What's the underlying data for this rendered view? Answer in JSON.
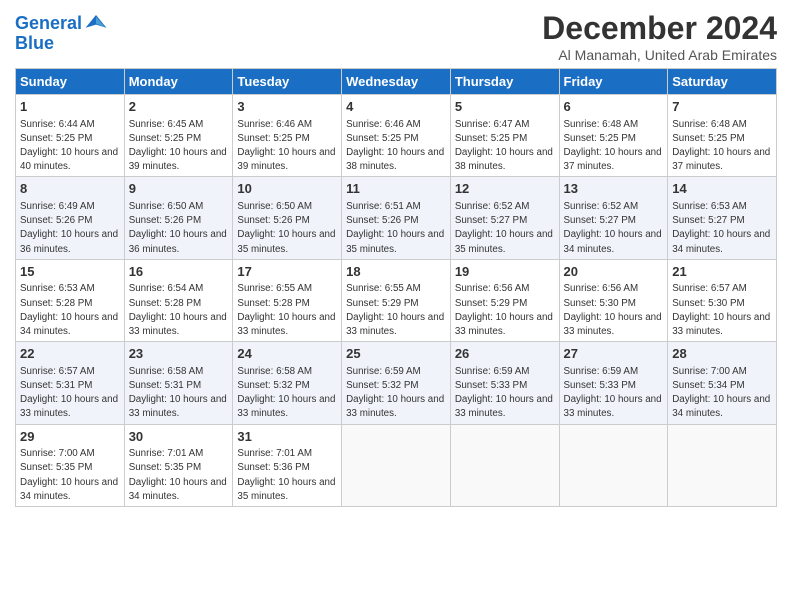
{
  "logo": {
    "line1": "General",
    "line2": "Blue"
  },
  "title": "December 2024",
  "subtitle": "Al Manamah, United Arab Emirates",
  "days_header": [
    "Sunday",
    "Monday",
    "Tuesday",
    "Wednesday",
    "Thursday",
    "Friday",
    "Saturday"
  ],
  "weeks": [
    [
      {
        "num": "1",
        "sunrise": "6:44 AM",
        "sunset": "5:25 PM",
        "daylight": "10 hours and 40 minutes."
      },
      {
        "num": "2",
        "sunrise": "6:45 AM",
        "sunset": "5:25 PM",
        "daylight": "10 hours and 39 minutes."
      },
      {
        "num": "3",
        "sunrise": "6:46 AM",
        "sunset": "5:25 PM",
        "daylight": "10 hours and 39 minutes."
      },
      {
        "num": "4",
        "sunrise": "6:46 AM",
        "sunset": "5:25 PM",
        "daylight": "10 hours and 38 minutes."
      },
      {
        "num": "5",
        "sunrise": "6:47 AM",
        "sunset": "5:25 PM",
        "daylight": "10 hours and 38 minutes."
      },
      {
        "num": "6",
        "sunrise": "6:48 AM",
        "sunset": "5:25 PM",
        "daylight": "10 hours and 37 minutes."
      },
      {
        "num": "7",
        "sunrise": "6:48 AM",
        "sunset": "5:25 PM",
        "daylight": "10 hours and 37 minutes."
      }
    ],
    [
      {
        "num": "8",
        "sunrise": "6:49 AM",
        "sunset": "5:26 PM",
        "daylight": "10 hours and 36 minutes."
      },
      {
        "num": "9",
        "sunrise": "6:50 AM",
        "sunset": "5:26 PM",
        "daylight": "10 hours and 36 minutes."
      },
      {
        "num": "10",
        "sunrise": "6:50 AM",
        "sunset": "5:26 PM",
        "daylight": "10 hours and 35 minutes."
      },
      {
        "num": "11",
        "sunrise": "6:51 AM",
        "sunset": "5:26 PM",
        "daylight": "10 hours and 35 minutes."
      },
      {
        "num": "12",
        "sunrise": "6:52 AM",
        "sunset": "5:27 PM",
        "daylight": "10 hours and 35 minutes."
      },
      {
        "num": "13",
        "sunrise": "6:52 AM",
        "sunset": "5:27 PM",
        "daylight": "10 hours and 34 minutes."
      },
      {
        "num": "14",
        "sunrise": "6:53 AM",
        "sunset": "5:27 PM",
        "daylight": "10 hours and 34 minutes."
      }
    ],
    [
      {
        "num": "15",
        "sunrise": "6:53 AM",
        "sunset": "5:28 PM",
        "daylight": "10 hours and 34 minutes."
      },
      {
        "num": "16",
        "sunrise": "6:54 AM",
        "sunset": "5:28 PM",
        "daylight": "10 hours and 33 minutes."
      },
      {
        "num": "17",
        "sunrise": "6:55 AM",
        "sunset": "5:28 PM",
        "daylight": "10 hours and 33 minutes."
      },
      {
        "num": "18",
        "sunrise": "6:55 AM",
        "sunset": "5:29 PM",
        "daylight": "10 hours and 33 minutes."
      },
      {
        "num": "19",
        "sunrise": "6:56 AM",
        "sunset": "5:29 PM",
        "daylight": "10 hours and 33 minutes."
      },
      {
        "num": "20",
        "sunrise": "6:56 AM",
        "sunset": "5:30 PM",
        "daylight": "10 hours and 33 minutes."
      },
      {
        "num": "21",
        "sunrise": "6:57 AM",
        "sunset": "5:30 PM",
        "daylight": "10 hours and 33 minutes."
      }
    ],
    [
      {
        "num": "22",
        "sunrise": "6:57 AM",
        "sunset": "5:31 PM",
        "daylight": "10 hours and 33 minutes."
      },
      {
        "num": "23",
        "sunrise": "6:58 AM",
        "sunset": "5:31 PM",
        "daylight": "10 hours and 33 minutes."
      },
      {
        "num": "24",
        "sunrise": "6:58 AM",
        "sunset": "5:32 PM",
        "daylight": "10 hours and 33 minutes."
      },
      {
        "num": "25",
        "sunrise": "6:59 AM",
        "sunset": "5:32 PM",
        "daylight": "10 hours and 33 minutes."
      },
      {
        "num": "26",
        "sunrise": "6:59 AM",
        "sunset": "5:33 PM",
        "daylight": "10 hours and 33 minutes."
      },
      {
        "num": "27",
        "sunrise": "6:59 AM",
        "sunset": "5:33 PM",
        "daylight": "10 hours and 33 minutes."
      },
      {
        "num": "28",
        "sunrise": "7:00 AM",
        "sunset": "5:34 PM",
        "daylight": "10 hours and 34 minutes."
      }
    ],
    [
      {
        "num": "29",
        "sunrise": "7:00 AM",
        "sunset": "5:35 PM",
        "daylight": "10 hours and 34 minutes."
      },
      {
        "num": "30",
        "sunrise": "7:01 AM",
        "sunset": "5:35 PM",
        "daylight": "10 hours and 34 minutes."
      },
      {
        "num": "31",
        "sunrise": "7:01 AM",
        "sunset": "5:36 PM",
        "daylight": "10 hours and 35 minutes."
      },
      null,
      null,
      null,
      null
    ]
  ]
}
